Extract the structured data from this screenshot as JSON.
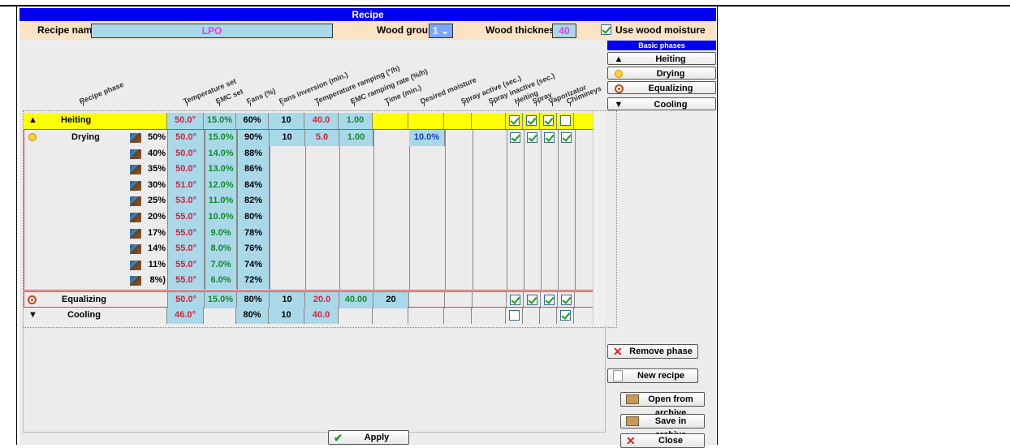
{
  "window": {
    "title": "Recipe"
  },
  "header": {
    "recipe_name_label": "Recipe name",
    "recipe_name_value": "LPO",
    "wood_group_label": "Wood group",
    "wood_group_value": "1",
    "wood_thickness_label": "Wood thickness",
    "wood_thickness_value": "40",
    "use_wood_moisture_label": "Use wood moisture",
    "use_wood_moisture_checked": true
  },
  "columns": [
    "Recipe phase",
    "Temperature set",
    "EMC set",
    "Fans (%)",
    "Fans inversion (min.)",
    "Temperature ramping (°/h)",
    "EMC ramping rate (%/h)",
    "Time (min.)",
    "Desired moisture",
    "Spray active (sec.)",
    "Spray inactive (sec.)",
    "Heiting",
    "Spray",
    "Vaporizator",
    "Chimineys"
  ],
  "phases": {
    "heiting": {
      "name": "Heiting",
      "temp": "50.0°",
      "emc": "15.0%",
      "fans": "60%",
      "inv": "10",
      "ramp": "40.0",
      "emcramp": "1.00",
      "checks": [
        true,
        true,
        true,
        false
      ]
    },
    "drying": {
      "name": "Drying",
      "inv": "10",
      "ramp": "5.0",
      "emcramp": "1.00",
      "moisture": "10.0%",
      "checks": [
        true,
        true,
        true,
        true
      ],
      "steps": [
        {
          "pct": "50%",
          "temp": "50.0°",
          "emc": "15.0%",
          "fans": "90%"
        },
        {
          "pct": "40%",
          "temp": "50.0°",
          "emc": "14.0%",
          "fans": "88%"
        },
        {
          "pct": "35%",
          "temp": "50.0°",
          "emc": "13.0%",
          "fans": "86%"
        },
        {
          "pct": "30%",
          "temp": "51.0°",
          "emc": "12.0%",
          "fans": "84%"
        },
        {
          "pct": "25%",
          "temp": "53.0°",
          "emc": "11.0%",
          "fans": "82%"
        },
        {
          "pct": "20%",
          "temp": "55.0°",
          "emc": "10.0%",
          "fans": "80%"
        },
        {
          "pct": "17%",
          "temp": "55.0°",
          "emc": "9.0%",
          "fans": "78%"
        },
        {
          "pct": "14%",
          "temp": "55.0°",
          "emc": "8.0%",
          "fans": "76%"
        },
        {
          "pct": "11%",
          "temp": "55.0°",
          "emc": "7.0%",
          "fans": "74%"
        },
        {
          "pct": "8%)",
          "temp": "55.0°",
          "emc": "6.0%",
          "fans": "72%"
        }
      ]
    },
    "equalizing": {
      "name": "Equalizing",
      "temp": "50.0°",
      "emc": "15.0%",
      "fans": "80%",
      "inv": "10",
      "ramp": "20.0",
      "emcramp": "40.00",
      "time": "20",
      "checks": [
        true,
        true,
        true,
        true
      ]
    },
    "cooling": {
      "name": "Cooling",
      "temp": "46.0°",
      "emc": "",
      "fans": "80%",
      "inv": "10",
      "ramp": "40.0",
      "checks": [
        false,
        false,
        false,
        true
      ]
    }
  },
  "sidebar": {
    "title": "Basic phases",
    "buttons": [
      {
        "label": "Heiting",
        "icon": "triangle-up-icon"
      },
      {
        "label": "Drying",
        "icon": "sun-icon"
      },
      {
        "label": "Equalizing",
        "icon": "target-icon"
      },
      {
        "label": "Cooling",
        "icon": "triangle-down-icon"
      }
    ],
    "remove_phase": "Remove phase",
    "new_recipe": "New recipe",
    "open_archive": "Open from archive",
    "save_archive": "Save in archive",
    "close": "Close"
  },
  "footer": {
    "apply": "Apply"
  },
  "colors": {
    "title_blue": "#0000f0",
    "topbar": "#fbe3c3",
    "heiting_row": "#ffff00",
    "value_red": "#d2233a",
    "value_green": "#138a2a"
  }
}
